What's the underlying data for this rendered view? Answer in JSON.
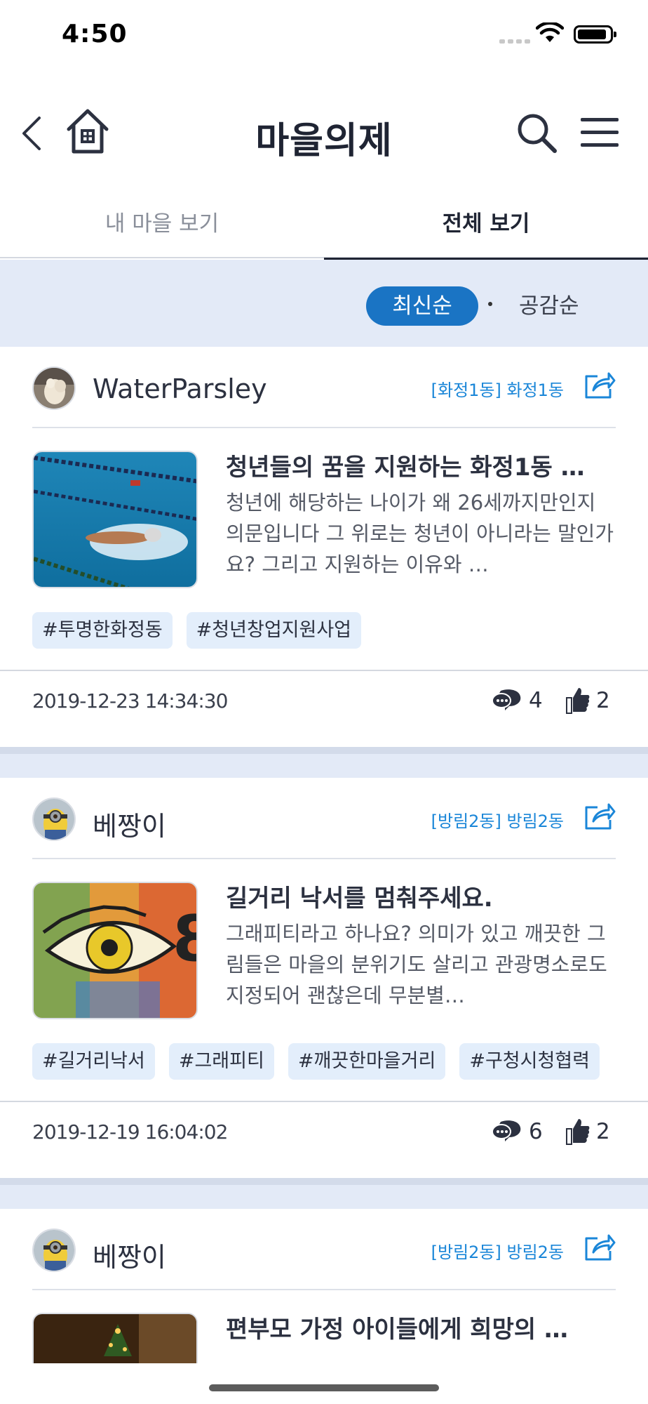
{
  "status_bar": {
    "time": "4:50"
  },
  "nav": {
    "title": "마을의제"
  },
  "tabs": [
    {
      "label": "내 마을 보기",
      "active": false
    },
    {
      "label": "전체 보기",
      "active": true
    }
  ],
  "sort": {
    "latest_label": "최신순",
    "empathy_label": "공감순",
    "active": "최신순"
  },
  "posts": [
    {
      "author": "WaterParsley",
      "location": "[화정1동] 화정1동",
      "title": "청년들의 꿈을 지원하는 화정1동 …",
      "body": "청년에 해당하는 나이가 왜 26세까지만인지 의문입니다 그 위로는 청년이 아니라는 말인가요? 그리고 지원하는 이유와 …",
      "tags": [
        "#투명한화정동",
        "#청년창업지원사업"
      ],
      "date": "2019-12-23 14:34:30",
      "comments": "4",
      "likes": "2"
    },
    {
      "author": "베짱이",
      "location": "[방림2동] 방림2동",
      "title": "길거리 낙서를 멈춰주세요.",
      "body": "그래피티라고 하나요? 의미가 있고 깨끗한 그림들은 마을의 분위기도 살리고 관광명소로도 지정되어 괜찮은데 무분별…",
      "tags": [
        "#길거리낙서",
        "#그래피티",
        "#깨끗한마을거리",
        "#구청시청협력"
      ],
      "date": "2019-12-19 16:04:02",
      "comments": "6",
      "likes": "2"
    },
    {
      "author": "베짱이",
      "location": "[방림2동] 방림2동",
      "title": "편부모 가정 아이들에게 희망의 …"
    }
  ],
  "colors": {
    "accent": "#1a74c4",
    "link": "#1a86d8",
    "sort_bg": "#e3eaf7",
    "tag_bg": "#e3eefb",
    "text": "#1f2433"
  },
  "icons": [
    "back-icon",
    "home-icon",
    "search-icon",
    "menu-icon",
    "share-icon",
    "comment-icon",
    "thumbs-up-icon",
    "wifi-icon",
    "battery-icon",
    "signal-icon"
  ]
}
